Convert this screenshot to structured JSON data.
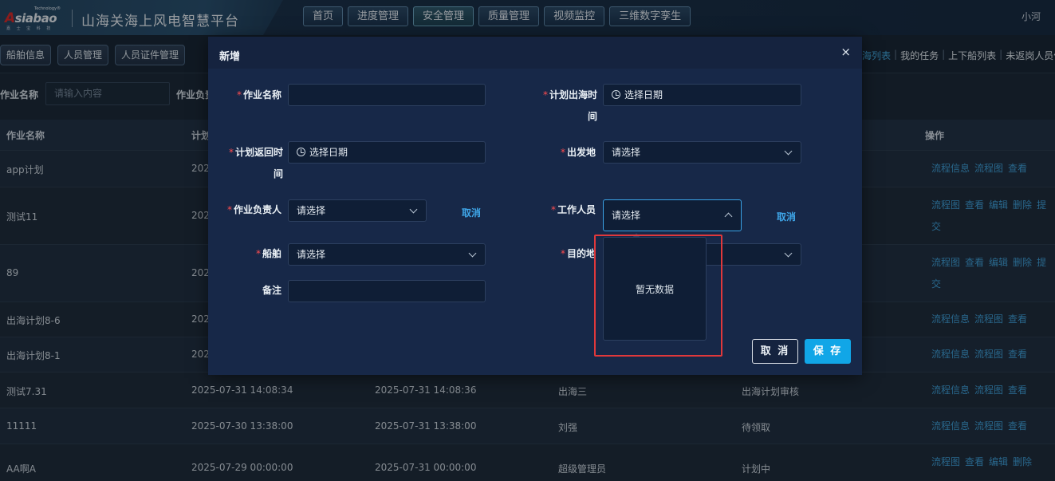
{
  "header": {
    "logo": {
      "technology": "Technology®",
      "brand_a": "A",
      "brand_rest": "siabao",
      "sub": "嘉 士 宝 科 技"
    },
    "title": "山海关海上风电智慧平台",
    "nav": [
      "首页",
      "进度管理",
      "安全管理",
      "质量管理",
      "视频监控",
      "三维数字孪生"
    ],
    "active_nav": "安全管理",
    "user": "小河"
  },
  "subnav": {
    "tabs": [
      "船舶信息",
      "人员管理",
      "人员证件管理"
    ],
    "right_links": [
      "海列表",
      "我的任务",
      "上下船列表",
      "未返岗人员信"
    ]
  },
  "filter": {
    "name_label": "作业名称",
    "name_placeholder": "请输入内容",
    "leader_label": "作业负责"
  },
  "table": {
    "headers": [
      "作业名称",
      "计划",
      "操作"
    ],
    "rows": [
      {
        "name": "app计划",
        "c2": "202",
        "c3": "",
        "c4": "",
        "c5": "",
        "actions": [
          "流程信息",
          "流程图",
          "查看"
        ]
      },
      {
        "name": "测试11",
        "c2": "202",
        "c3": "",
        "c4": "",
        "c5": "",
        "actions": [
          "流程图",
          "查看",
          "编辑",
          "删除",
          "提交"
        ]
      },
      {
        "name": "89",
        "c2": "202",
        "c3": "",
        "c4": "",
        "c5": "",
        "actions": [
          "流程图",
          "查看",
          "编辑",
          "删除",
          "提交"
        ]
      },
      {
        "name": "出海计划8-6",
        "c2": "202",
        "c3": "",
        "c4": "",
        "c5": "",
        "actions": [
          "流程信息",
          "流程图",
          "查看"
        ]
      },
      {
        "name": "出海计划8-1",
        "c2": "202",
        "c3": "",
        "c4": "",
        "c5": "",
        "actions": [
          "流程信息",
          "流程图",
          "查看"
        ]
      },
      {
        "name": "测试7.31",
        "c2": "2025-07-31 14:08:34",
        "c3": "2025-07-31 14:08:36",
        "c4": "出海三",
        "c5": "出海计划审核",
        "actions": [
          "流程信息",
          "流程图",
          "查看"
        ]
      },
      {
        "name": "11111",
        "c2": "2025-07-30 13:38:00",
        "c3": "2025-07-31 13:38:00",
        "c4": "刘强",
        "c5": "待领取",
        "actions": [
          "流程信息",
          "流程图",
          "查看"
        ]
      },
      {
        "name": "AA啊A",
        "c2": "2025-07-29 00:00:00",
        "c3": "2025-07-31 00:00:00",
        "c4": "超级管理员",
        "c5": "计划中",
        "actions": [
          "流程图",
          "查看",
          "编辑",
          "删除"
        ]
      }
    ]
  },
  "modal": {
    "title": "新增",
    "close": "×",
    "fields": {
      "job_name": {
        "label": "作业名称",
        "value": ""
      },
      "plan_out_time": {
        "label": "计划出海时间",
        "placeholder": "选择日期"
      },
      "plan_return_time": {
        "label": "计划返回时间",
        "placeholder": "选择日期"
      },
      "departure": {
        "label": "出发地",
        "placeholder": "请选择"
      },
      "leader": {
        "label": "作业负责人",
        "placeholder": "请选择",
        "cancel": "取消"
      },
      "workers": {
        "label": "工作人员",
        "placeholder": "请选择",
        "cancel": "取消"
      },
      "ship": {
        "label": "船舶",
        "placeholder": "请选择"
      },
      "destination": {
        "label": "目的地"
      },
      "remark": {
        "label": "备注",
        "value": ""
      }
    },
    "dropdown_empty": "暂无数据",
    "buttons": {
      "cancel": "取 消",
      "save": "保 存"
    }
  },
  "colors": {
    "accent": "#11a6e7",
    "link": "#3f9fd8",
    "required": "#ff4d4f",
    "highlight_box": "#e0383b"
  }
}
